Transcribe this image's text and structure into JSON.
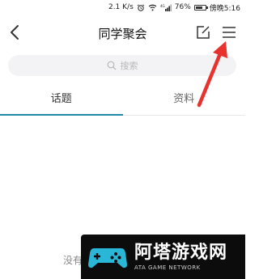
{
  "status_bar": {
    "speed": "2.1 K/s",
    "network": "4G",
    "battery": "76%",
    "battery_level": 0.76,
    "time": "傍晚5:16"
  },
  "header": {
    "title": "同学聚会"
  },
  "search": {
    "placeholder": "搜索"
  },
  "tabs": [
    {
      "label": "话题",
      "active": true
    },
    {
      "label": "资料",
      "active": false
    }
  ],
  "content": {
    "empty_text": "没有"
  },
  "colors": {
    "accent": "#1e8aa8",
    "annotation_arrow": "#e8322e"
  },
  "watermark": {
    "title": "阿塔游戏网",
    "subtitle": "ATA GAME NETWORK"
  }
}
